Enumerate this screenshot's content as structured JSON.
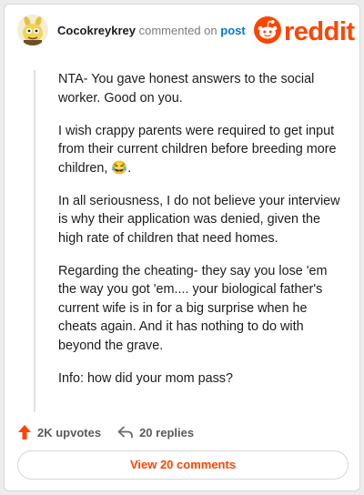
{
  "header": {
    "username": "Cocokreykrey",
    "action_text": "commented on",
    "post_link": "post",
    "logo_text": "reddit"
  },
  "comment": {
    "paragraphs": [
      "NTA- You gave honest answers to the social worker. Good on you.",
      "I wish crappy parents were required to get input from their current children before breeding more children, 😂.",
      "In all seriousness, I do not believe your interview is why their application was denied, given the high rate of children that need homes.",
      "Regarding the cheating- they say you lose 'em the way you got 'em.... your biological father's current wife is in for a big surprise when he cheats again. And it has nothing to do with beyond the grave.",
      "Info: how did your mom pass?"
    ]
  },
  "stats": {
    "upvotes_label": "2K upvotes",
    "replies_label": "20 replies"
  },
  "footer": {
    "view_comments_label": "View 20 comments"
  },
  "colors": {
    "brand": "#ff4500",
    "link": "#0079d3"
  },
  "icons": {
    "upvote": "upvote-arrow-icon",
    "reply": "reply-arrow-icon",
    "logo": "reddit-snoo-icon",
    "avatar": "user-avatar"
  }
}
